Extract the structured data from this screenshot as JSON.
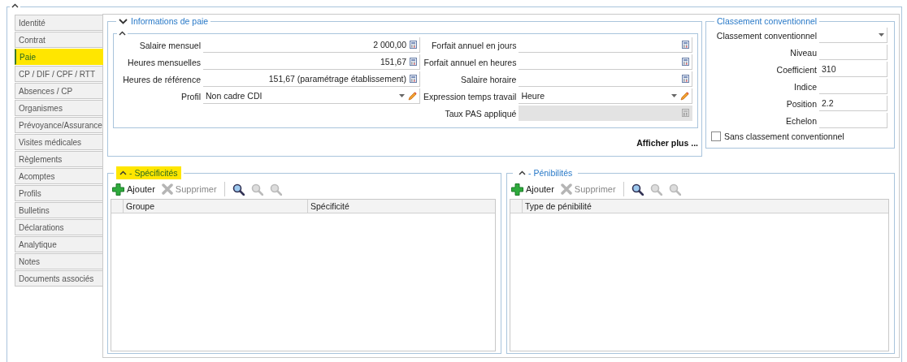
{
  "tabs": [
    {
      "label": "Identité",
      "selected": false,
      "highlighted": false
    },
    {
      "label": "Contrat",
      "selected": false,
      "highlighted": false
    },
    {
      "label": "Paie",
      "selected": true,
      "highlighted": true
    },
    {
      "label": "CP / DIF / CPF / RTT",
      "selected": false,
      "highlighted": false
    },
    {
      "label": "Absences / CP",
      "selected": false,
      "highlighted": false
    },
    {
      "label": "Organismes",
      "selected": false,
      "highlighted": false
    },
    {
      "label": "Prévoyance/Assurance",
      "selected": false,
      "highlighted": false
    },
    {
      "label": "Visites médicales",
      "selected": false,
      "highlighted": false
    },
    {
      "label": "Règlements",
      "selected": false,
      "highlighted": false
    },
    {
      "label": "Acomptes",
      "selected": false,
      "highlighted": false
    },
    {
      "label": "Profils",
      "selected": false,
      "highlighted": false
    },
    {
      "label": "Bulletins",
      "selected": false,
      "highlighted": false
    },
    {
      "label": "Déclarations",
      "selected": false,
      "highlighted": false
    },
    {
      "label": "Analytique",
      "selected": false,
      "highlighted": false
    },
    {
      "label": "Notes",
      "selected": false,
      "highlighted": false
    },
    {
      "label": "Documents associés",
      "selected": false,
      "highlighted": false
    }
  ],
  "pay_info": {
    "title": "Informations de paie",
    "expanded": true,
    "left_fields": [
      {
        "label": "Salaire mensuel",
        "value": "2 000,00",
        "kind": "calc",
        "disabled": false
      },
      {
        "label": "Heures mensuelles",
        "value": "151,67",
        "kind": "calc",
        "disabled": false
      },
      {
        "label": "Heures de référence",
        "value": "151,67 (paramétrage établissement)",
        "kind": "calc",
        "disabled": false
      },
      {
        "label": "Profil",
        "value": "Non cadre CDI",
        "kind": "combo-edit",
        "disabled": false
      }
    ],
    "right_fields": [
      {
        "label": "Forfait annuel en jours",
        "kind": "calc",
        "disabled": false
      },
      {
        "label": "Forfait annuel en heures",
        "kind": "calc",
        "disabled": false
      },
      {
        "label": "Salaire horaire",
        "kind": "calc",
        "disabled": false
      },
      {
        "label": "Expression temps travail",
        "value": "Heure",
        "kind": "combo-edit",
        "disabled": false
      },
      {
        "label": "Taux PAS appliqué",
        "kind": "calc",
        "disabled": true
      }
    ],
    "more_link": "Afficher plus ..."
  },
  "classification": {
    "title": "Classement conventionnel",
    "fields": [
      {
        "label": "Classement conventionnel",
        "kind": "dropdown"
      },
      {
        "label": "Niveau",
        "kind": "text"
      },
      {
        "label": "Coefficient",
        "value": "310",
        "kind": "text"
      },
      {
        "label": "Indice",
        "kind": "text"
      },
      {
        "label": "Position",
        "value": "2.2",
        "kind": "text"
      },
      {
        "label": "Echelon",
        "kind": "text"
      }
    ],
    "checkbox": {
      "label": "Sans classement conventionnel",
      "checked": false
    }
  },
  "lists": [
    {
      "title": "- Spécificités",
      "highlighted": true,
      "toolbar": [
        {
          "label": "Ajouter",
          "kind": "add",
          "disabled": false
        },
        {
          "label": "Supprimer",
          "kind": "delete",
          "disabled": true
        },
        {
          "kind": "search",
          "disabled": false
        },
        {
          "kind": "search-prev",
          "disabled": true
        },
        {
          "kind": "search-next",
          "disabled": true
        }
      ],
      "columns": [
        "Groupe",
        "Spécificité"
      ]
    },
    {
      "title": "- Pénibilités",
      "highlighted": false,
      "toolbar": [
        {
          "label": "Ajouter",
          "kind": "add",
          "disabled": false
        },
        {
          "label": "Supprimer",
          "kind": "delete",
          "disabled": true
        },
        {
          "kind": "search",
          "disabled": false
        },
        {
          "kind": "search-prev",
          "disabled": true
        },
        {
          "kind": "search-next",
          "disabled": true
        }
      ],
      "columns": [
        "Type de pénibilité"
      ]
    }
  ]
}
